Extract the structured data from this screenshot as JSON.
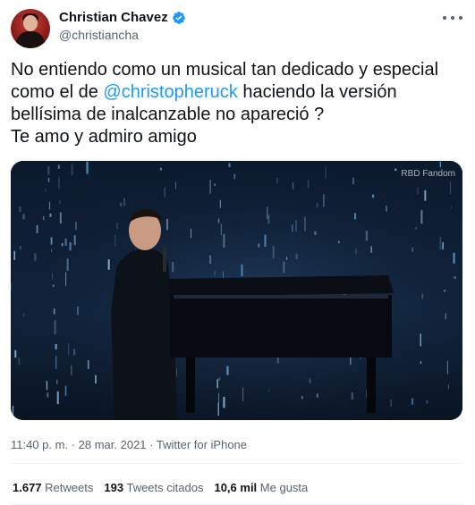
{
  "author": {
    "display_name": "Christian Chavez",
    "handle": "@christiancha",
    "verified": true,
    "avatar_icon": "avatar-photo"
  },
  "tweet": {
    "text_before": "No entiendo como un musical tan dedicado y especial como el de ",
    "mention": "@christopheruck",
    "text_after": " haciendo la versión bellísima de inalcanzable no apareció ?",
    "line2": "Te amo y admiro amigo"
  },
  "media": {
    "watermark": "RBD Fandom",
    "description_icon": "video-still"
  },
  "meta": {
    "time": "11:40 p. m.",
    "separator": " · ",
    "date": "28 mar. 2021",
    "source": "Twitter for iPhone"
  },
  "stats": [
    {
      "value": "1.677",
      "label": "Retweets"
    },
    {
      "value": "193",
      "label": "Tweets citados"
    },
    {
      "value": "10,6 mil",
      "label": "Me gusta"
    }
  ],
  "colors": {
    "accent": "#1d9bf0",
    "text": "#0f1419",
    "secondary": "#536471",
    "divider": "#eff3f4"
  },
  "icons": {
    "verified": "verified-badge-icon",
    "more": "more-icon"
  }
}
